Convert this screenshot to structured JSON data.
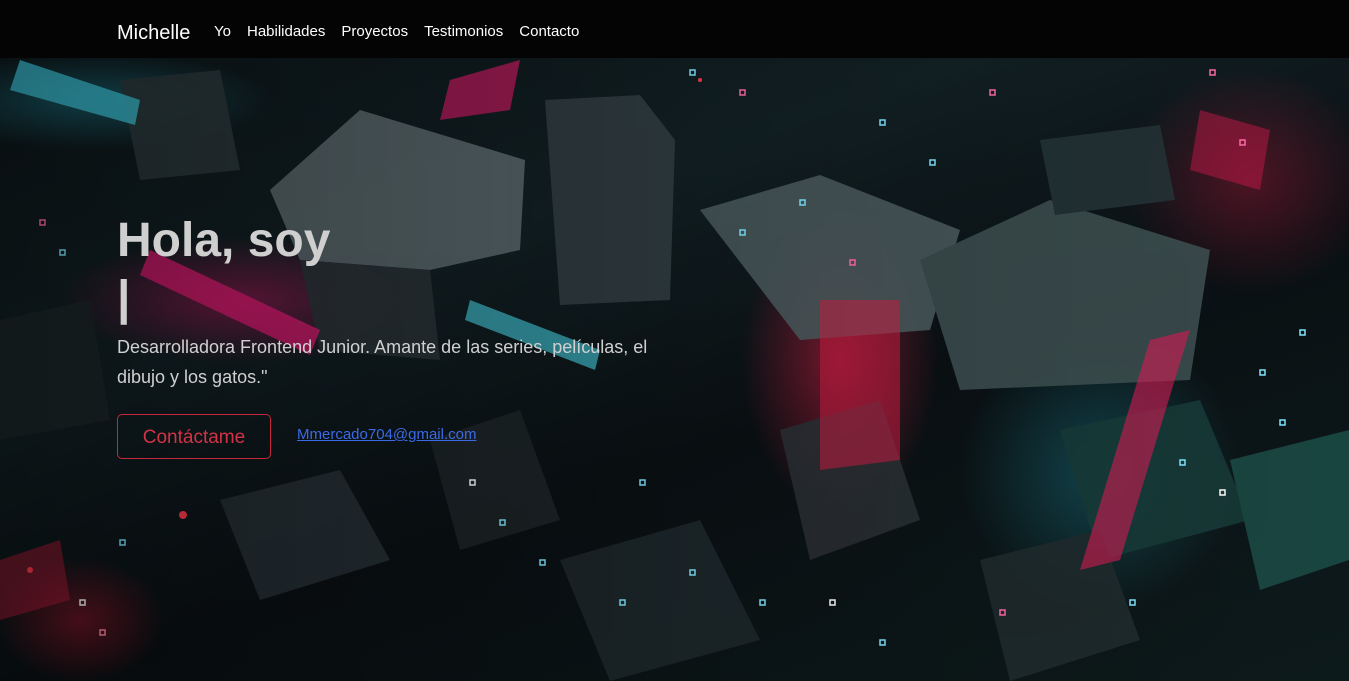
{
  "navbar": {
    "brand": "Michelle",
    "links": [
      {
        "label": "Yo"
      },
      {
        "label": "Habilidades"
      },
      {
        "label": "Proyectos"
      },
      {
        "label": "Testimonios"
      },
      {
        "label": "Contacto"
      }
    ]
  },
  "hero": {
    "title": "Hola, soy",
    "cursor": "|",
    "description": "Desarrolladora Frontend Junior. Amante de las series, películas, el dibujo y los gatos.\"",
    "contact_button": "Contáctame",
    "email": "Mmercado704@gmail.com"
  },
  "colors": {
    "navbar_bg": "#040404",
    "accent_red": "#c8263a",
    "link_blue": "#3b6ae6"
  }
}
